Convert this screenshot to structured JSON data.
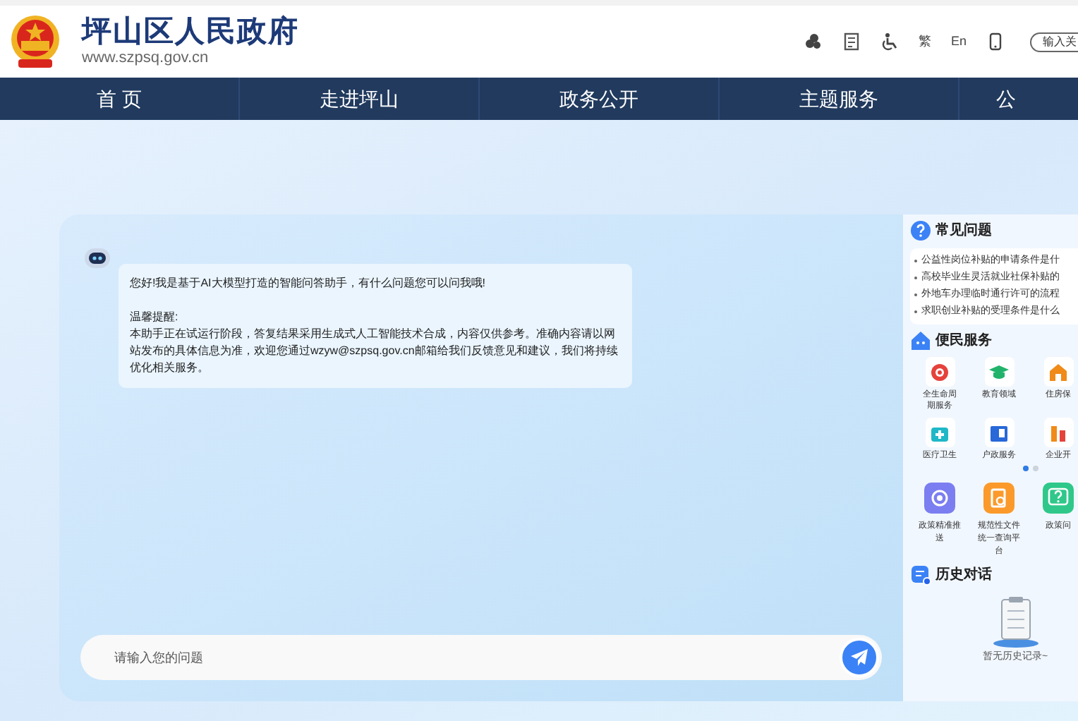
{
  "header": {
    "site_title": "坪山区人民政府",
    "site_url": "www.szpsq.gov.cn",
    "tools": [
      {
        "kind": "icon"
      },
      {
        "kind": "icon"
      },
      {
        "kind": "icon"
      },
      {
        "kind": "text",
        "label": "繁"
      },
      {
        "kind": "text",
        "label": "En"
      },
      {
        "kind": "icon"
      }
    ],
    "search": {
      "placeholder": "输入关"
    }
  },
  "nav": [
    "首 页",
    "走进坪山",
    "政务公开",
    "主题服务",
    "公"
  ],
  "chat": {
    "messages": [
      {
        "greeting": "您好!我是基于AI大模型打造的智能问答助手，有什么问题您可以问我哦!",
        "notice_title": "温馨提醒:",
        "notice_body": "本助手正在试运行阶段，答复结果采用生成式人工智能技术合成，内容仅供参考。准确内容请以网站发布的具体信息为准，欢迎您通过wzyw@szpsq.gov.cn邮箱给我们反馈意见和建议，我们将持续优化相关服务。"
      }
    ],
    "input": {
      "placeholder": "请输入您的问题"
    }
  },
  "sidebar": {
    "faq": {
      "title": "常见问题",
      "items": [
        "公益性岗位补贴的申请条件是什",
        "高校毕业生灵活就业社保补贴的",
        "外地车办理临时通行许可的流程",
        "求职创业补贴的受理条件是什么"
      ]
    },
    "services": {
      "title": "便民服务",
      "items": [
        "全生命周期服务",
        "教育领域",
        "住房保",
        "医疗卫生",
        "户政服务",
        "企业开"
      ],
      "pages": [
        {
          "selected": true
        },
        {
          "selected": false
        }
      ]
    },
    "tools": [
      {
        "label": "政策精准推送",
        "color": "#7b7ef0"
      },
      {
        "label": "规范性文件统一查询平台",
        "color": "#fb9a2a"
      },
      {
        "label": "政策问",
        "color": "#2fc88a"
      }
    ],
    "history": {
      "title": "历史对话",
      "empty": "暂无历史记录~"
    }
  }
}
